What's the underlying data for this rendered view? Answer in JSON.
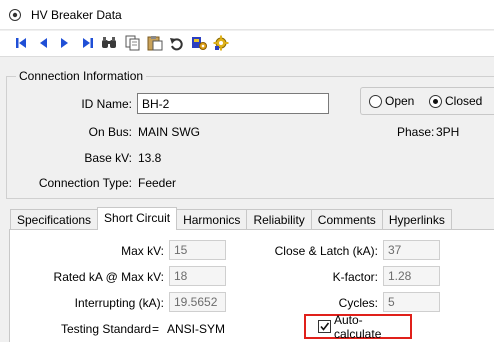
{
  "window": {
    "title": "HV Breaker Data",
    "icon": "settings-circle-icon"
  },
  "toolbar": {
    "buttons": [
      {
        "name": "first-record",
        "icon": "first-record-icon"
      },
      {
        "name": "previous-record",
        "icon": "previous-record-icon"
      },
      {
        "name": "next-record",
        "icon": "next-record-icon"
      },
      {
        "name": "last-record",
        "icon": "last-record-icon"
      },
      {
        "name": "find",
        "icon": "binoculars-icon"
      },
      {
        "name": "copy",
        "icon": "copy-icon"
      },
      {
        "name": "paste",
        "icon": "paste-icon"
      },
      {
        "name": "undo",
        "icon": "undo-icon"
      },
      {
        "name": "library",
        "icon": "library-icon"
      },
      {
        "name": "settings",
        "icon": "gear-icon"
      }
    ]
  },
  "connection": {
    "group_label": "Connection Information",
    "id_label": "ID Name:",
    "id_value": "BH-2",
    "bus_label": "On Bus:",
    "bus_value": "MAIN SWG",
    "kv_label": "Base kV:",
    "kv_value": "13.8",
    "type_label": "Connection Type:",
    "type_value": "Feeder",
    "phase_label": "Phase:",
    "phase_value": "3PH",
    "open_label": "Open",
    "closed_label": "Closed",
    "state": "Closed"
  },
  "tabs": {
    "items": [
      {
        "label": "Specifications"
      },
      {
        "label": "Short Circuit",
        "active": true
      },
      {
        "label": "Harmonics"
      },
      {
        "label": "Reliability"
      },
      {
        "label": "Comments"
      },
      {
        "label": "Hyperlinks"
      }
    ]
  },
  "short_circuit": {
    "max_kv_label": "Max kV:",
    "max_kv_value": "15",
    "rated_ka_label": "Rated kA @ Max kV:",
    "rated_ka_value": "18",
    "interrupting_label": "Interrupting (kA):",
    "interrupting_value": "19.5652",
    "testing_label": "Testing Standard",
    "testing_eq": "=",
    "testing_value": "ANSI-SYM",
    "close_latch_label": "Close & Latch (kA):",
    "close_latch_value": "37",
    "kfactor_label": "K-factor:",
    "kfactor_value": "1.28",
    "cycles_label": "Cycles:",
    "cycles_value": "5",
    "autocalc_label": "Auto-calculate",
    "autocalc_checked": true,
    "highlight_color": "#e0201a"
  }
}
